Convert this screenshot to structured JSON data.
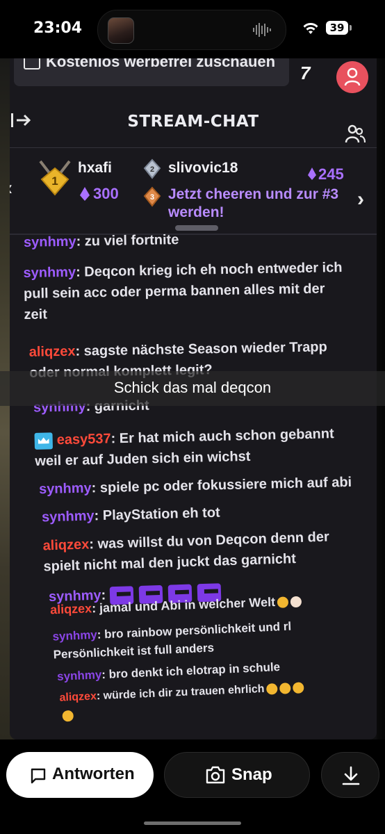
{
  "status_bar": {
    "time": "23:04",
    "battery": "39"
  },
  "stream": {
    "ad_banner": "Kostenlos werbefrei zuschauen",
    "turbo_label": "7",
    "chat_title": "STREAM-CHAT",
    "leaderboard": {
      "first": {
        "name": "hxafi",
        "bits": "300",
        "rank": "1"
      },
      "second": {
        "name": "slivovic18",
        "bits": "245",
        "rank": "2"
      },
      "third": {
        "rank": "3",
        "cheer_text": "Jetzt cheeren und zur #3 werden!"
      }
    },
    "messages": [
      {
        "user": "synhmy",
        "text": ": zu viel fortnite"
      },
      {
        "user": "synhmy",
        "line1": ": Deqcon krieg ich eh noch entweder ich",
        "line2": "pull sein acc oder perma bannen alles mit der",
        "line3": "zeit"
      },
      {
        "user": "aliqzex",
        "line1": ": sagste nächste Season wieder Trapp",
        "line2": "oder normal komplett legit?"
      },
      {
        "user": "synhmy",
        "text": ": garnicht"
      },
      {
        "user": "easy537",
        "line1": ": Er hat mich auch schon gebannt",
        "line2": "weil er auf Juden sich ein wichst"
      },
      {
        "user": "synhmy",
        "text": ": spiele pc oder fokussiere mich auf abi"
      },
      {
        "user": "synhmy",
        "text": ": PlayStation eh tot"
      },
      {
        "user": "aliqzex",
        "line1": ": was willst du von Deqcon denn der",
        "line2": "spielt nicht mal den juckt das garnicht"
      },
      {
        "user": "synhmy",
        "text": ":"
      },
      {
        "user": "aliqzex",
        "text": ": jamal und Abi in welcher Welt"
      },
      {
        "user": "synhmy",
        "line1": ": bro rainbow persönlichkeit und rl",
        "line2": "Persönlichkeit ist full anders"
      },
      {
        "user": "synhmy",
        "text": ": bro denkt ich elotrap in schule"
      },
      {
        "user": "aliqzex",
        "text": ": würde ich dir zu trauen ehrlich"
      }
    ]
  },
  "caption": "Schick das mal deqcon",
  "bottom_bar": {
    "reply_label": "Antworten",
    "snap_label": "Snap"
  }
}
